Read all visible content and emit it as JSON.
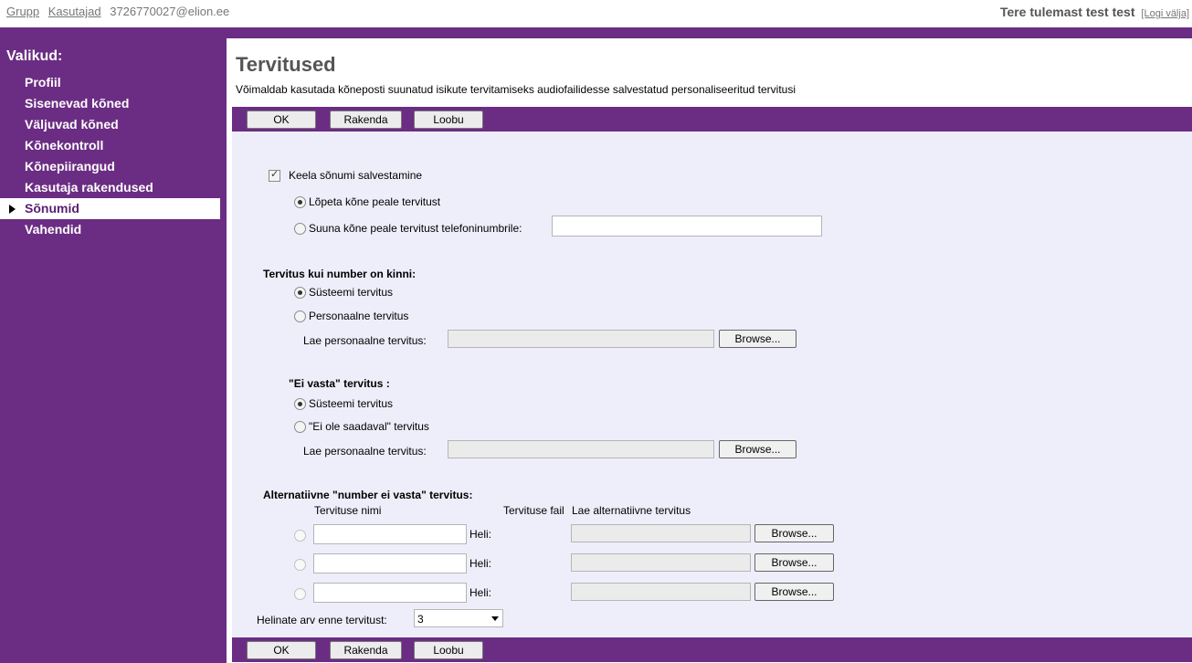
{
  "topbar": {
    "link_group": "Grupp",
    "link_users": "Kasutajad",
    "email": "3726770027@elion.ee",
    "welcome": "Tere tulemast test test",
    "logout": "[Logi välja]"
  },
  "sidebar": {
    "heading": "Valikud:",
    "items": [
      {
        "label": "Profiil"
      },
      {
        "label": "Sisenevad kõned"
      },
      {
        "label": "Väljuvad kõned"
      },
      {
        "label": "Kõnekontroll"
      },
      {
        "label": "Kõnepiirangud"
      },
      {
        "label": "Kasutaja rakendused"
      },
      {
        "label": "Sõnumid"
      },
      {
        "label": "Vahendid"
      }
    ],
    "active_index": 6
  },
  "page": {
    "title": "Tervitused",
    "description": "Võimaldab kasutada kõneposti suunatud isikute tervitamiseks audiofailidesse salvestatud personaliseeritud tervitusi"
  },
  "buttons": {
    "ok": "OK",
    "apply": "Rakenda",
    "cancel": "Loobu"
  },
  "form": {
    "disable_save_label": "Keela sõnumi salvestamine",
    "end_call_label": "Lõpeta kõne peale tervitust",
    "forward_label": "Suuna kõne peale tervitust telefoninumbrile:",
    "forward_value": "",
    "busy": {
      "heading": "Tervitus kui number on kinni:",
      "system_label": "Süsteemi tervitus",
      "personal_label": "Personaalne tervitus",
      "upload_label": "Lae personaalne tervitus:",
      "browse": "Browse..."
    },
    "noanswer": {
      "heading": "\"Ei vasta\" tervitus :",
      "system_label": "Süsteemi tervitus",
      "unavailable_label": "\"Ei ole saadaval\" tervitus",
      "upload_label": "Lae personaalne tervitus:",
      "browse": "Browse..."
    },
    "alt": {
      "heading": "Alternatiivne \"number ei vasta\" tervitus:",
      "col_name": "Tervituse nimi",
      "col_file": "Tervituse fail",
      "col_upload": "Lae alternatiivne tervitus",
      "rows": [
        {
          "name": "",
          "sound_label": "Heli:",
          "browse": "Browse..."
        },
        {
          "name": "",
          "sound_label": "Heli:",
          "browse": "Browse..."
        },
        {
          "name": "",
          "sound_label": "Heli:",
          "browse": "Browse..."
        }
      ]
    },
    "rings_label": "Helinate arv enne tervitust:",
    "rings_value": "3"
  }
}
